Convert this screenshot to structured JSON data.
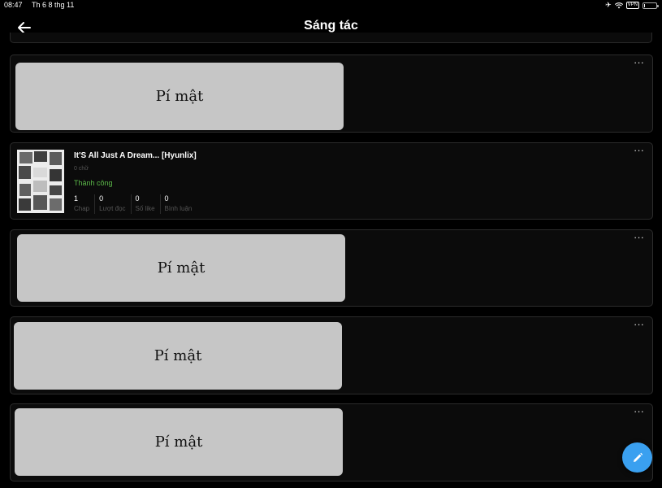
{
  "status_bar": {
    "time": "08:47",
    "date": "Th 6 8 thg 11",
    "vpn_label": "VPN",
    "battery_level": 0.1,
    "icons": [
      "airplane-icon",
      "wifi-icon",
      "vpn-badge",
      "battery-icon"
    ]
  },
  "header": {
    "title": "Sáng tác",
    "back_icon": "arrow-left-icon"
  },
  "cards": [
    {
      "secret_label": "Pí mật",
      "more_label": "···"
    },
    {
      "more_label": "···",
      "title": "It'S All Just A Dream... [Hyunlix]",
      "words": "0 chữ",
      "status": "Thành công",
      "stats": [
        {
          "value": "1",
          "label": "Chap"
        },
        {
          "value": "0",
          "label": "Lượt đọc"
        },
        {
          "value": "0",
          "label": "Số like"
        },
        {
          "value": "0",
          "label": "Bình luận"
        }
      ]
    },
    {
      "secret_label": "Pí mật",
      "more_label": "···"
    },
    {
      "secret_label": "Pí mật",
      "more_label": "···"
    },
    {
      "secret_label": "Pí mật",
      "more_label": "···"
    }
  ],
  "fab": {
    "icon": "pencil-icon"
  },
  "colors": {
    "background": "#000000",
    "card_background": "#0b0b0b",
    "secret_cover": "#c6c6c6",
    "status_success": "#5dbb4a",
    "fab": "#3aa0f0"
  }
}
